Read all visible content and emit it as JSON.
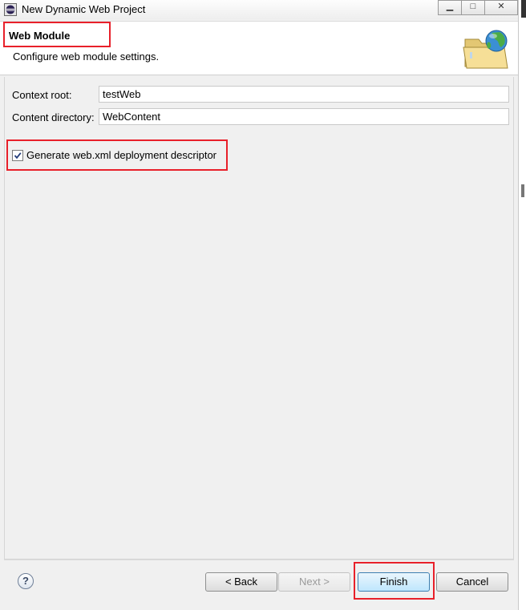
{
  "window": {
    "title": "New Dynamic Web Project",
    "app_icon": "eclipse-icon",
    "controls": [
      "minimize-icon",
      "maximize-icon",
      "close-icon"
    ],
    "control_glyphs": {
      "minimize": "▁",
      "maximize": "□",
      "close": "✕"
    }
  },
  "header": {
    "title": "Web Module",
    "description": "Configure web module settings.",
    "icon": "web-folder-icon"
  },
  "form": {
    "context_root": {
      "label": "Context root:",
      "value": "testWeb"
    },
    "content_directory": {
      "label": "Content directory:",
      "value": "WebContent"
    },
    "generate_descriptor": {
      "label": "Generate web.xml deployment descriptor",
      "checked": true
    }
  },
  "footer": {
    "help_glyph": "?",
    "back_label": "< Back",
    "next_label": "Next >",
    "finish_label": "Finish",
    "cancel_label": "Cancel"
  },
  "colors": {
    "highlight": "#e8202a",
    "dialog_bg": "#f0f0f0",
    "header_bg": "#ffffff",
    "default_button": "#bee6fd"
  }
}
